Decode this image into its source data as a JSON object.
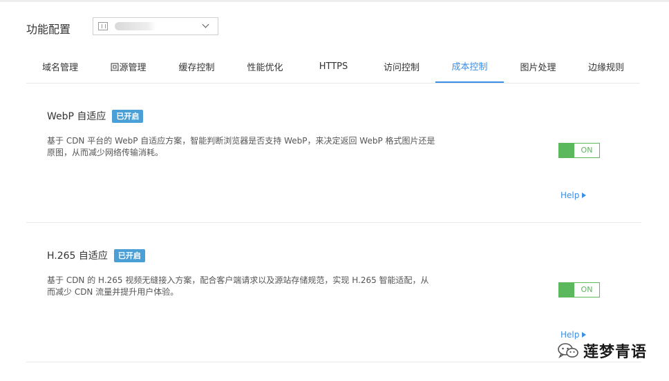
{
  "header": {
    "title": "功能配置"
  },
  "tabs": [
    {
      "label": "域名管理"
    },
    {
      "label": "回源管理"
    },
    {
      "label": "缓存控制"
    },
    {
      "label": "性能优化"
    },
    {
      "label": "HTTPS"
    },
    {
      "label": "访问控制"
    },
    {
      "label": "成本控制",
      "active": true
    },
    {
      "label": "图片处理"
    },
    {
      "label": "边缘规则"
    }
  ],
  "sections": [
    {
      "title": "WebP 自适应",
      "badge": "已开启",
      "desc_line1": "基于 CDN 平台的 WebP 自适应方案，智能判断浏览器是否支持 WebP，来决定返回 WebP 格式图片还是",
      "desc_line2": "原图，从而减少网络传输消耗。",
      "toggle_label": "ON",
      "help_label": "Help"
    },
    {
      "title": "H.265 自适应",
      "badge": "已开启",
      "desc_line1": "基于 CDN 的 H.265 视频无缝接入方案，配合客户端请求以及源站存储规范，实现 H.265 智能适配，从",
      "desc_line2": "而减少 CDN 流量并提升用户体验。",
      "toggle_label": "ON",
      "help_label": "Help"
    }
  ],
  "watermark": {
    "text": "莲梦青语",
    "icon": "wechat-icon"
  },
  "colors": {
    "accent": "#3a8ee6",
    "badge": "#4aa0d6",
    "toggle_on": "#5cb85c"
  }
}
